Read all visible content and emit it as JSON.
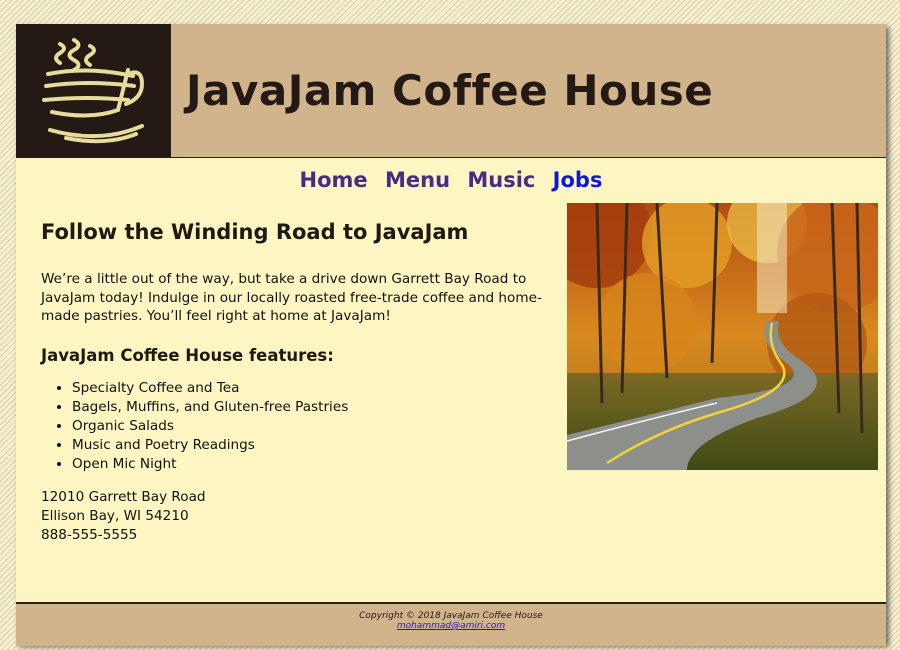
{
  "site": {
    "title": "JavaJam Coffee House",
    "logo": "coffee-cup-logo"
  },
  "nav": {
    "items": [
      {
        "label": "Home"
      },
      {
        "label": "Menu"
      },
      {
        "label": "Music"
      },
      {
        "label": "Jobs"
      }
    ]
  },
  "main": {
    "heading": "Follow the Winding Road to JavaJam",
    "intro": "We’re a little out of the way, but take a drive down Garrett Bay Road to JavaJam today! Indulge in our locally roasted free-trade coffee and home-made pastries. You’ll feel right at home at JavaJam!",
    "features_heading": "JavaJam Coffee House features:",
    "features": [
      "Specialty Coffee and Tea",
      "Bagels, Muffins, and Gluten-free Pastries",
      "Organic Salads",
      "Music and Poetry Readings",
      "Open Mic Night"
    ],
    "address": {
      "street": "12010 Garrett Bay Road",
      "city": "Ellison Bay, WI 54210",
      "phone": "888-555-5555"
    },
    "hero_image": "winding-road-autumn-photo"
  },
  "footer": {
    "copyright": "Copyright © 2018 JavaJam Coffee House",
    "email": "mohammad@amiri.com"
  },
  "colors": {
    "header_bg": "#d2b48c",
    "content_bg": "#fef6c2",
    "logo_bg": "#231915",
    "nav_link": "#4a2a86",
    "nav_active": "#0b19d6"
  }
}
